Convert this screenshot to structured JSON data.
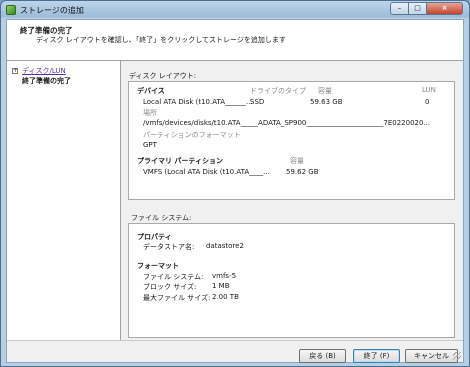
{
  "window": {
    "title": "ストレージの追加",
    "controls": {
      "minimize": "–",
      "maximize": "□",
      "close": "×"
    }
  },
  "header": {
    "title": "終了準備の完了",
    "subtitle": "ディスク レイアウトを確認し、「終了」をクリックしてストレージを追加します"
  },
  "nav": {
    "expander": "+",
    "items": [
      {
        "label": "ディスク/LUN",
        "state": "link"
      },
      {
        "label": "終了準備の完了",
        "state": "current"
      }
    ]
  },
  "disk_layout": {
    "section_label": "ディスク レイアウト:",
    "device_heading": "デバイス",
    "col_drive_type": "ドライブのタイプ",
    "col_capacity": "容量",
    "col_lun": "LUN",
    "device_name": "Local ATA Disk (t10.ATA______...",
    "drive_type": "SSD",
    "capacity": "59.63 GB",
    "lun": "0",
    "location_label": "場所",
    "location_value": "/vmfs/devices/disks/t10.ATA_____ADATA_SP900______________________7E0220020...",
    "partition_format_label": "パーティションのフォーマット",
    "partition_format_value": "GPT",
    "primary_partition_heading": "プライマリ パーティション",
    "pp_capacity_label": "容量",
    "pp_name": "VMFS (Local ATA Disk (t10.ATA____...",
    "pp_capacity": "59.62 GB"
  },
  "file_system": {
    "section_label": "ファイル システム:",
    "properties_heading": "プロパティ",
    "datastore_name_label": "データストア名:",
    "datastore_name_value": "datastore2",
    "format_heading": "フォーマット",
    "fs_label": "ファイル システム:",
    "fs_value": "vmfs-5",
    "block_size_label": "ブロック サイズ:",
    "block_size_value": "1 MB",
    "max_file_size_label": "最大ファイル サイズ:",
    "max_file_size_value": "2.00 TB"
  },
  "buttons": {
    "back": "戻る (B)",
    "finish": "終了 (F)",
    "cancel": "キャンセル"
  },
  "colors": {
    "titlebar": "#bcd5ea",
    "link": "#5a2fa8",
    "muted_text": "#8a8a8a",
    "close_button": "#c5442c"
  }
}
